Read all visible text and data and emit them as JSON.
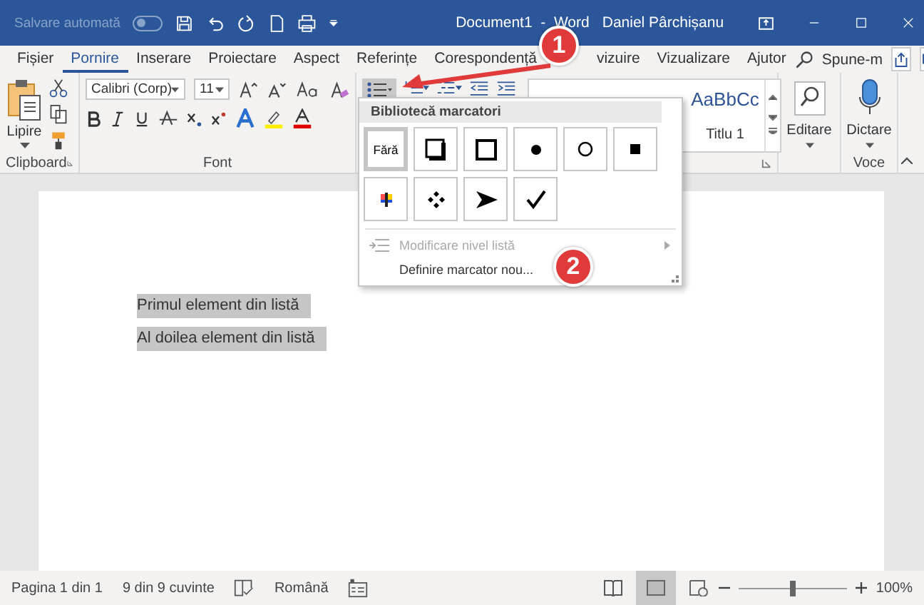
{
  "title_bar": {
    "autosave_label": "Salvare automată",
    "autosave_on": false,
    "document_title": "Document1  -  Word",
    "user_name": "Daniel Pârchișanu"
  },
  "ribbon_tabs": [
    {
      "label": "Fișier",
      "selected": false
    },
    {
      "label": "Pornire",
      "selected": true
    },
    {
      "label": "Inserare",
      "selected": false
    },
    {
      "label": "Proiectare",
      "selected": false
    },
    {
      "label": "Aspect",
      "selected": false
    },
    {
      "label": "Referințe",
      "selected": false
    },
    {
      "label": "Corespondență",
      "selected": false
    },
    {
      "label": "vizuire",
      "selected": false
    },
    {
      "label": "Vizualizare",
      "selected": false
    },
    {
      "label": "Ajutor",
      "selected": false
    }
  ],
  "tell_me": "Spune-m",
  "clipboard": {
    "paste_label": "Lipire",
    "group_label": "Clipboard"
  },
  "font": {
    "family": "Calibri (Corp)",
    "size": "11",
    "group_label": "Font"
  },
  "styles": [
    {
      "preview": "AaBbCc",
      "name": "Titlu 1"
    }
  ],
  "editing": {
    "label": "Editare"
  },
  "voice": {
    "label": "Dictare",
    "group_label": "Voce"
  },
  "bullet_menu": {
    "heading": "Bibliotecă marcatori",
    "bullets": [
      {
        "kind": "none",
        "text": "Fără",
        "selected": true
      },
      {
        "kind": "shadow-square",
        "selected": false
      },
      {
        "kind": "square",
        "selected": false
      },
      {
        "kind": "dot",
        "selected": false
      },
      {
        "kind": "circle",
        "selected": false
      },
      {
        "kind": "small-square",
        "selected": false
      },
      {
        "kind": "picture",
        "selected": false
      },
      {
        "kind": "diamonds",
        "selected": false
      },
      {
        "kind": "arrowhead",
        "selected": false
      },
      {
        "kind": "check",
        "selected": false
      }
    ],
    "items": [
      {
        "label": "Modificare nivel listă",
        "disabled": true,
        "submenu": true
      },
      {
        "label": "Definire marcator nou...",
        "disabled": false,
        "submenu": false
      }
    ]
  },
  "document": {
    "paragraphs": [
      {
        "text": "Primul element din listă",
        "selected": true
      },
      {
        "text": "Al doilea element din listă",
        "selected": true
      }
    ]
  },
  "status_bar": {
    "page": "Pagina 1 din 1",
    "words": "9 din 9 cuvinte",
    "language": "Română",
    "views": [
      {
        "kind": "read",
        "selected": false
      },
      {
        "kind": "print",
        "selected": true
      },
      {
        "kind": "web",
        "selected": false
      }
    ],
    "zoom": {
      "level": 0.5,
      "reading": "100%"
    }
  },
  "callouts": [
    {
      "number": "1"
    },
    {
      "number": "2"
    }
  ]
}
